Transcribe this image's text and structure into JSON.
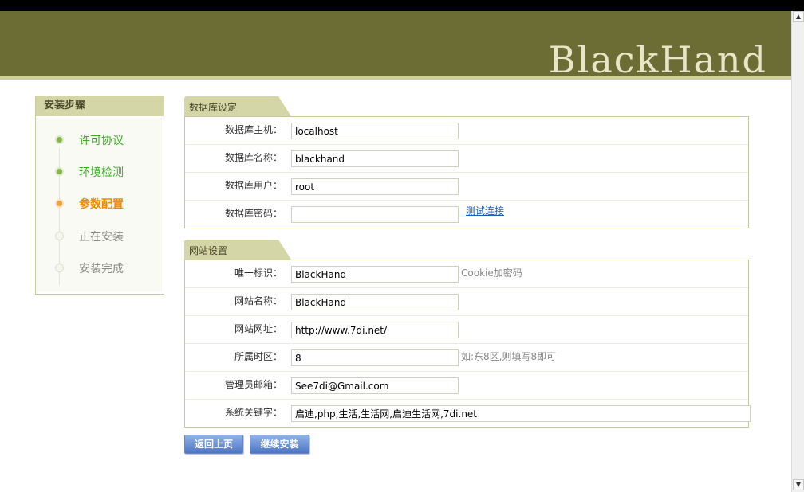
{
  "header": {
    "logo": "BlackHand"
  },
  "sidebar": {
    "title": "安装步骤",
    "steps": [
      {
        "label": "许可协议",
        "state": "done"
      },
      {
        "label": "环境检测",
        "state": "done"
      },
      {
        "label": "参数配置",
        "state": "current"
      },
      {
        "label": "正在安装",
        "state": "todo"
      },
      {
        "label": "安装完成",
        "state": "todo"
      }
    ]
  },
  "db": {
    "title": "数据库设定",
    "host_label": "数据库主机：",
    "host_value": "localhost",
    "name_label": "数据库名称：",
    "name_value": "blackhand",
    "user_label": "数据库用户：",
    "user_value": "root",
    "pass_label": "数据库密码：",
    "pass_value": "",
    "test_link": "测试连接"
  },
  "site": {
    "title": "网站设置",
    "uid_label": "唯一标识：",
    "uid_value": "BlackHand",
    "uid_hint": "Cookie加密码",
    "sitename_label": "网站名称：",
    "sitename_value": "BlackHand",
    "url_label": "网站网址：",
    "url_value": "http://www.7di.net/",
    "tz_label": "所属时区：",
    "tz_value": "8",
    "tz_hint": "如:东8区,则填写8即可",
    "email_label": "管理员邮箱：",
    "email_value": "See7di@Gmail.com",
    "kw_label": "系统关键字：",
    "kw_value": "启迪,php,生活,生活网,启迪生活网,7di.net"
  },
  "buttons": {
    "back": "返回上页",
    "next": "继续安装"
  }
}
